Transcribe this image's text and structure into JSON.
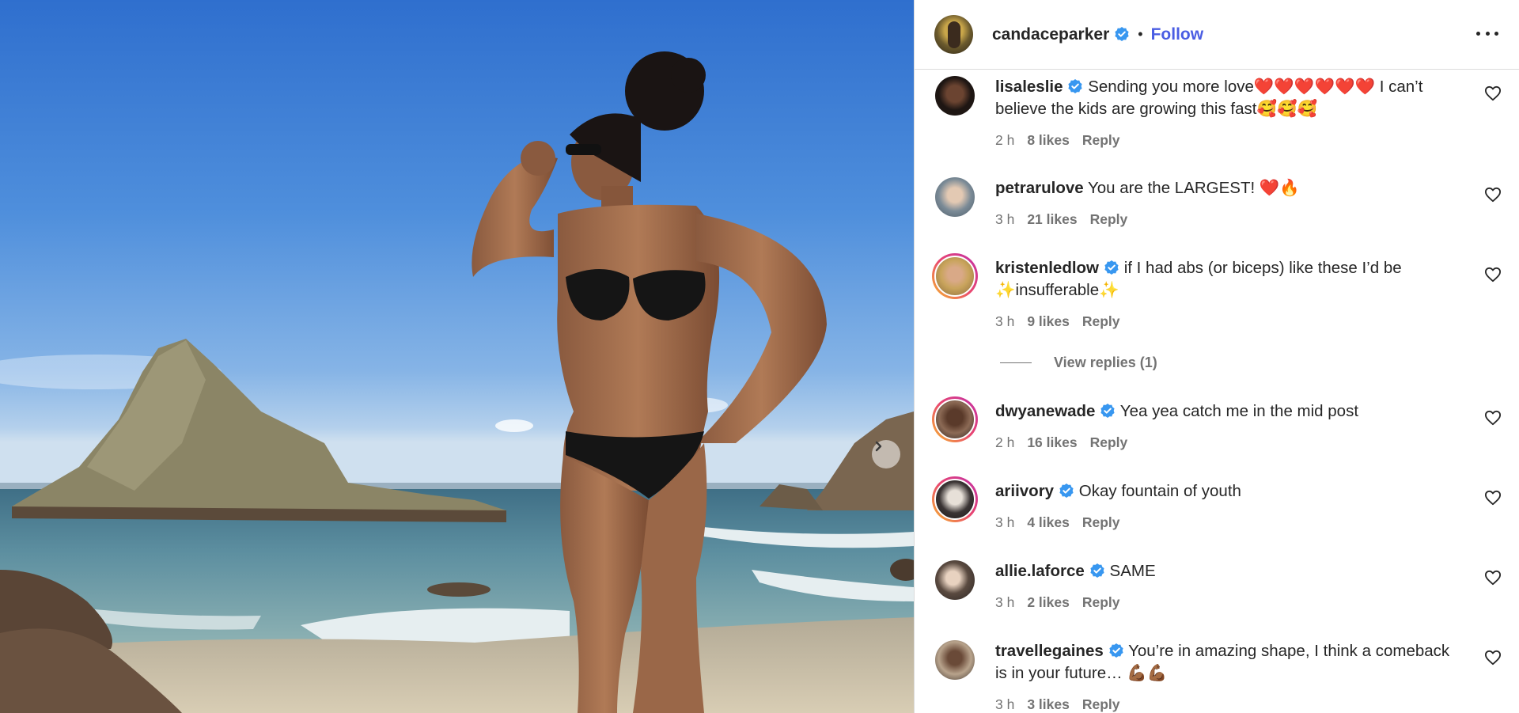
{
  "post": {
    "author": "candaceparker",
    "follow_label": "Follow",
    "separator": "•"
  },
  "comments": [
    {
      "user": "lisaleslie",
      "verified": true,
      "text": "Sending you more love❤️❤️❤️❤️❤️❤️ I can’t believe the kids are growing this fast🥰🥰🥰",
      "time": "2 h",
      "likes": "8 likes",
      "reply": "Reply"
    },
    {
      "user": "petrarulove",
      "verified": false,
      "text": "You are the LARGEST! ❤️🔥",
      "time": "3 h",
      "likes": "21 likes",
      "reply": "Reply"
    },
    {
      "user": "kristenledlow",
      "verified": true,
      "text": "if I had abs (or biceps) like these I’d be ✨insufferable✨",
      "time": "3 h",
      "likes": "9 likes",
      "reply": "Reply",
      "view_replies": "View replies (1)"
    },
    {
      "user": "dwyanewade",
      "verified": true,
      "text": "Yea yea catch me in the mid post",
      "time": "2 h",
      "likes": "16 likes",
      "reply": "Reply"
    },
    {
      "user": "ariivory",
      "verified": true,
      "text": "Okay fountain of youth",
      "time": "3 h",
      "likes": "4 likes",
      "reply": "Reply"
    },
    {
      "user": "allie.laforce",
      "verified": true,
      "text": "SAME",
      "time": "3 h",
      "likes": "2 likes",
      "reply": "Reply"
    },
    {
      "user": "travellegaines",
      "verified": true,
      "text": "You’re in amazing shape, I think a comeback is in your future… 💪🏾💪🏾",
      "time": "3 h",
      "likes": "3 likes",
      "reply": "Reply"
    }
  ],
  "icons": {
    "verified": "verified-badge-icon",
    "heart": "heart-outline-icon",
    "next": "chevron-right-icon",
    "more": "more-horizontal-icon"
  },
  "colors": {
    "verified": "#3897f0",
    "follow": "#4a5de3",
    "story_ring_start": "#f6b82e",
    "story_ring_end": "#c12fa8"
  }
}
